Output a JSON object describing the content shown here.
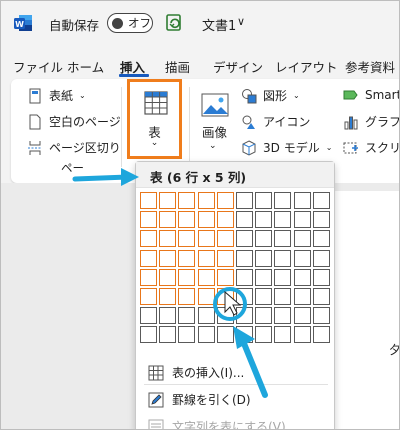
{
  "titlebar": {
    "autosave_label": "自動保存",
    "toggle_label": "オフ",
    "doc_title": "文書1",
    "chevron": "∨"
  },
  "tabs": [
    {
      "label": "ファイル"
    },
    {
      "label": "ホーム"
    },
    {
      "label": "挿入",
      "active": true
    },
    {
      "label": "描画"
    },
    {
      "label": "デザイン"
    },
    {
      "label": "レイアウト"
    },
    {
      "label": "参考資料"
    }
  ],
  "ribbon": {
    "cover_page": "表紙",
    "blank_page": "空白のページ",
    "page_break": "ページ区切り",
    "pages_group_label": "ペー",
    "table_label": "表",
    "image_label": "画像",
    "shapes": "図形",
    "icons": "アイコン",
    "models_3d": "3D モデル",
    "smartart": "SmartA",
    "graph": "グラフ",
    "screenshot": "スクリーン"
  },
  "colors": {
    "accent": "#f07d1c",
    "brand": "#185abd",
    "annotation": "#1ea6dc"
  },
  "dropdown": {
    "header": "表 (6 行 x 5 列)",
    "grid": {
      "rows": 8,
      "cols": 10,
      "selected_rows": 6,
      "selected_cols": 5
    },
    "items": [
      {
        "label": "表の挿入(I)...",
        "icon": "table-insert-icon",
        "disabled": false
      },
      {
        "label": "罫線を引く(D)",
        "icon": "pencil-icon",
        "disabled": false
      },
      {
        "label": "文字列を表にする(V)...",
        "icon": "convert-text-icon",
        "disabled": true
      }
    ]
  },
  "document": {
    "mark": "夕"
  }
}
